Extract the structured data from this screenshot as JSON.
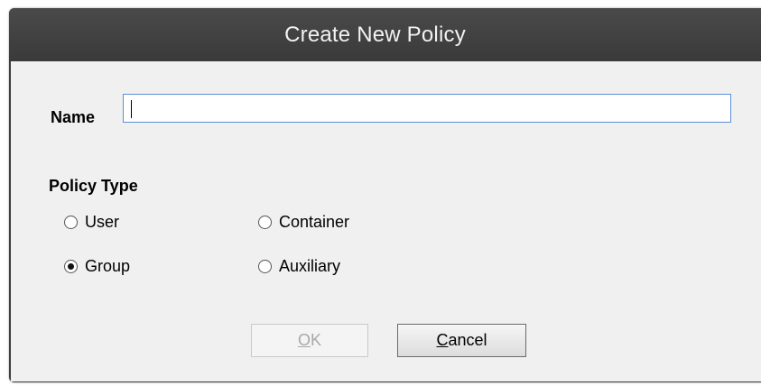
{
  "dialog": {
    "title": "Create New Policy",
    "name_label": "Name",
    "name_value": "",
    "policy_type_label": "Policy Type",
    "options": [
      {
        "label": "User",
        "selected": false
      },
      {
        "label": "Group",
        "selected": true
      },
      {
        "label": "Container",
        "selected": false
      },
      {
        "label": "Auxiliary",
        "selected": false
      }
    ],
    "ok_mnemonic": "O",
    "ok_rest": "K",
    "ok_enabled": false,
    "cancel_mnemonic": "C",
    "cancel_rest": "ancel"
  }
}
